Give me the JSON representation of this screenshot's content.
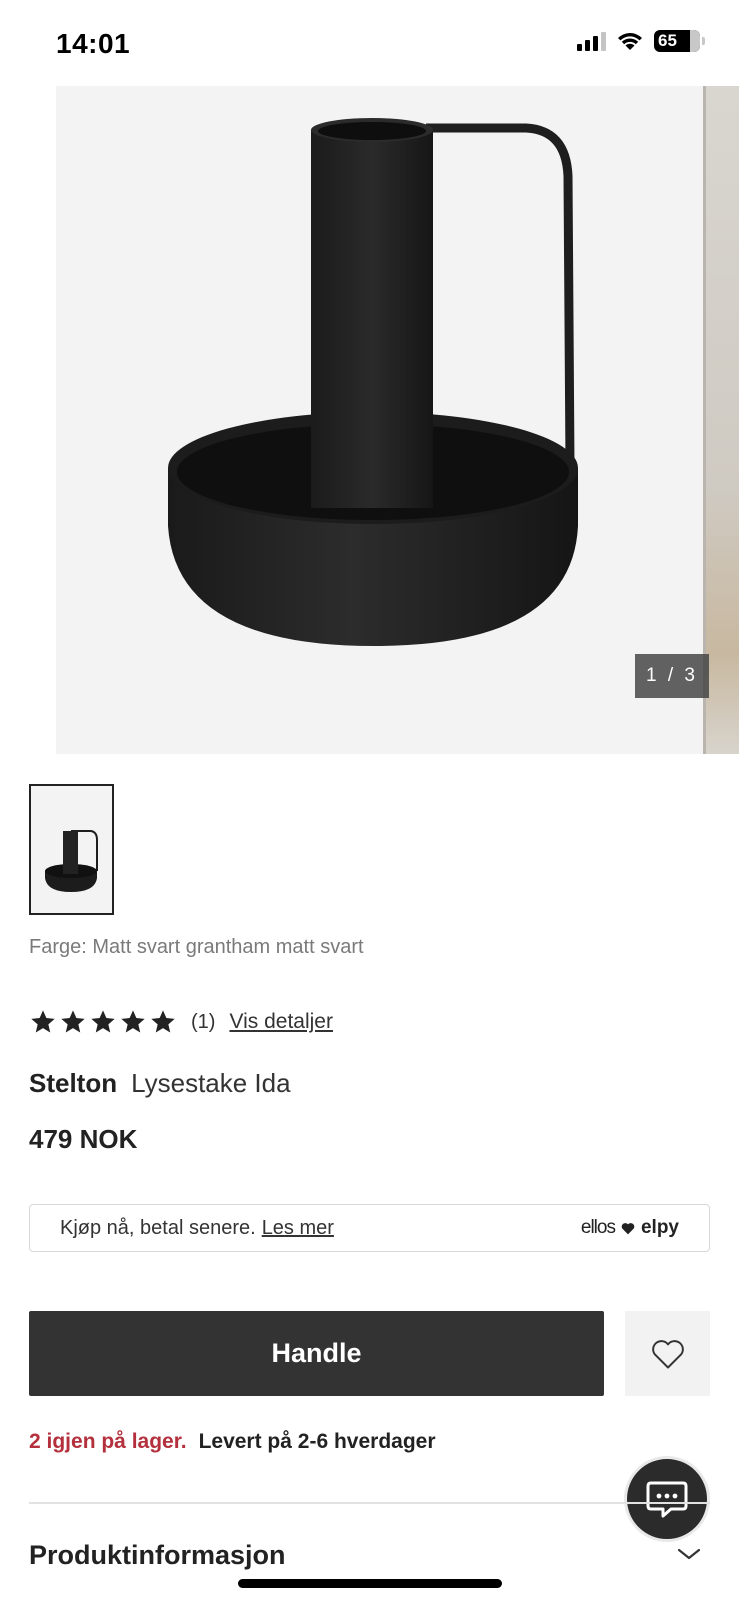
{
  "status_bar": {
    "time": "14:01",
    "battery": "65",
    "icons": [
      "signal-icon",
      "wifi-icon",
      "battery-icon"
    ]
  },
  "gallery": {
    "counter": "1 / 3",
    "current_image": "black-candle-holder-product-photo"
  },
  "product": {
    "color_line": "Farge: Matt svart grantham matt svart",
    "rating": {
      "stars": 5,
      "max_stars": 5,
      "count": "(1)",
      "link": "Vis detaljer"
    },
    "brand": "Stelton",
    "name": "Lysestake Ida",
    "price": "479 NOK"
  },
  "payment": {
    "text": "Kjøp nå, betal senere.",
    "link": "Les mer",
    "logo_left": "ellos",
    "logo_right": "elpy"
  },
  "actions": {
    "buy_label": "Handle"
  },
  "stock": {
    "availability": "2 igjen på lager.",
    "delivery": "Levert på 2-6 hverdager"
  },
  "sections": {
    "product_info": "Produktinformasjon"
  },
  "colors": {
    "primary_button": "#333333",
    "stock_red": "#b3303c",
    "text": "#222222"
  }
}
